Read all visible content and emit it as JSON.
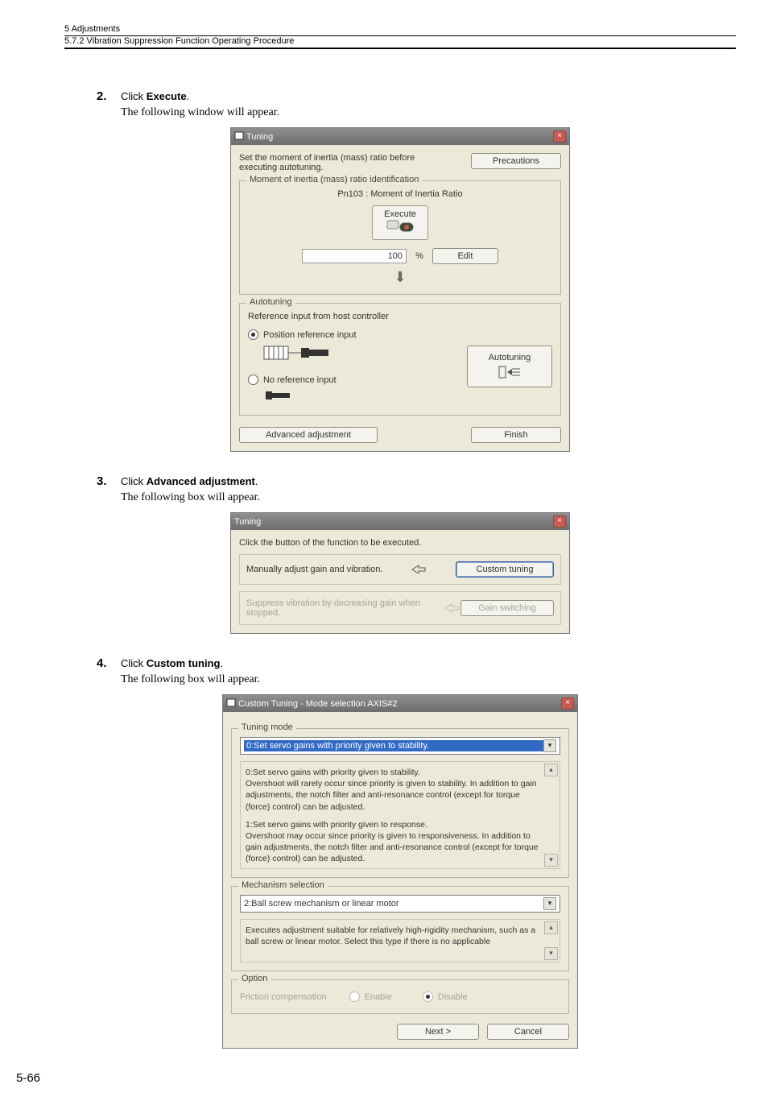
{
  "header": {
    "chapter": "5  Adjustments",
    "section": "5.7.2  Vibration Suppression Function Operating Procedure"
  },
  "step2": {
    "num": "2.",
    "action": "Click ",
    "action_bold": "Execute",
    "action_end": ".",
    "follow": "The following window will appear."
  },
  "dlg1": {
    "title": "Tuning",
    "text_top": "Set the moment of inertia (mass) ratio before executing autotuning.",
    "precautions_btn": "Precautions",
    "group1_legend": "Moment of inertia (mass) ratio identification",
    "pn_label": "Pn103 : Moment of Inertia Ratio",
    "execute_btn": "Execute",
    "value": "100",
    "percent": "%",
    "edit_btn": "Edit",
    "group2_legend": "Autotuning",
    "ref_label": "Reference input from host controller",
    "radio1": "Position reference input",
    "radio2": "No reference input",
    "autotuning_btn": "Autotuning",
    "advanced_btn": "Advanced adjustment",
    "finish_btn": "Finish"
  },
  "step3": {
    "num": "3.",
    "action": "Click ",
    "action_bold": "Advanced adjustment",
    "action_end": ".",
    "follow": "The following box will appear."
  },
  "dlg2": {
    "title": "Tuning",
    "instr": "Click the button of the function to be executed.",
    "row1_text": "Manually adjust gain and vibration.",
    "row1_btn": "Custom tuning",
    "row2_text": "Suppress vibration by decreasing gain when stopped.",
    "row2_btn": "Gain switching"
  },
  "step4": {
    "num": "4.",
    "action": "Click ",
    "action_bold": "Custom tuning",
    "action_end": ".",
    "follow": "The following box will appear."
  },
  "dlg3": {
    "title": "Custom Tuning - Mode selection AXIS#2",
    "group1_legend": "Tuning mode",
    "select1": "0:Set servo gains with priority given to stability.",
    "desc1a": "0:Set servo gains with priority given to stability.",
    "desc1b": "Overshoot will rarely occur since priority is given to stability. In addition to gain adjustments, the notch filter and anti-resonance control (except for torque (force) control) can be adjusted.",
    "desc1c": "1:Set servo gains with priority given to response.",
    "desc1d": "Overshoot may occur since priority is given to responsiveness. In addition to gain adjustments, the notch filter and anti-resonance control (except for torque (force) control) can be adjusted.",
    "group2_legend": "Mechanism selection",
    "select2": "2:Ball screw mechanism or linear motor",
    "desc2": "Executes adjustment suitable for relatively high-rigidity mechanism, such as a ball screw or linear motor. Select this type if there is no applicable",
    "group3_legend": "Option",
    "friction_label": "Friction compensation",
    "enable": "Enable",
    "disable": "Disable",
    "next_btn": "Next >",
    "cancel_btn": "Cancel"
  },
  "page_number": "5-66"
}
